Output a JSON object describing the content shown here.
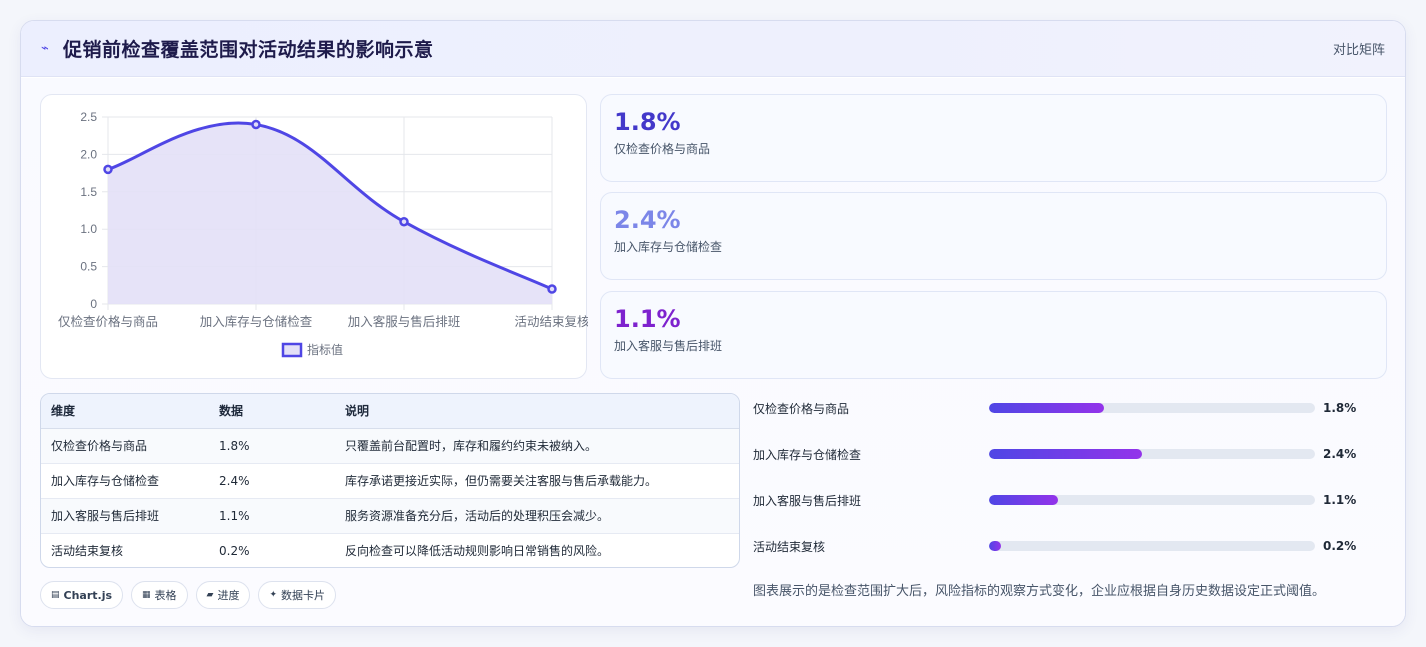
{
  "header": {
    "title": "促销前检查覆盖范围对活动结果的影响示意",
    "icon": "trend-icon",
    "right_label": "对比矩阵"
  },
  "chart_data": {
    "type": "line",
    "categories": [
      "仅检查价格与商品",
      "加入库存与仓储检查",
      "加入客服与售后排班",
      "活动结束复核"
    ],
    "series": [
      {
        "name": "指标值",
        "values": [
          1.8,
          2.4,
          1.1,
          0.2
        ]
      }
    ],
    "ylim": [
      0,
      2.5
    ],
    "yticks": [
      "0",
      "0.5",
      "1.0",
      "1.5",
      "2.0",
      "2.5"
    ],
    "grid": true,
    "legend_position": "bottom",
    "fill": true,
    "smooth": true,
    "line_color": "#4f46e5",
    "fill_color": "#e3e0f7"
  },
  "kpis": [
    {
      "value": "1.8%",
      "label": "仅检查价格与商品",
      "color": "#4338ca"
    },
    {
      "value": "2.4%",
      "label": "加入库存与仓储检查",
      "color": "#7c86e8"
    },
    {
      "value": "1.1%",
      "label": "加入客服与售后排班",
      "color": "#7e22ce"
    }
  ],
  "table": {
    "headers": [
      "维度",
      "数据",
      "说明"
    ],
    "rows": [
      [
        "仅检查价格与商品",
        "1.8%",
        "只覆盖前台配置时，库存和履约约束未被纳入。"
      ],
      [
        "加入库存与仓储检查",
        "2.4%",
        "库存承诺更接近实际，但仍需要关注客服与售后承载能力。"
      ],
      [
        "加入客服与售后排班",
        "1.1%",
        "服务资源准备充分后，活动后的处理积压会减少。"
      ],
      [
        "活动结束复核",
        "0.2%",
        "反向检查可以降低活动规则影响日常销售的风险。"
      ]
    ]
  },
  "chips": [
    {
      "label": "Chart.js",
      "icon": "chart-icon",
      "glyph": "▤"
    },
    {
      "label": "表格",
      "icon": "table-icon",
      "glyph": "▦"
    },
    {
      "label": "进度",
      "icon": "progress-icon",
      "glyph": "▰"
    },
    {
      "label": "数据卡片",
      "icon": "sparkle-icon",
      "glyph": "✦"
    }
  ],
  "progress": [
    {
      "label": "仅检查价格与商品",
      "value": "1.8%",
      "fraction": 0.352
    },
    {
      "label": "加入库存与仓储检查",
      "value": "2.4%",
      "fraction": 0.469
    },
    {
      "label": "加入客服与售后排班",
      "value": "1.1%",
      "fraction": 0.212
    },
    {
      "label": "活动结束复核",
      "value": "0.2%",
      "fraction": 0.036
    }
  ],
  "footnote": "图表展示的是检查范围扩大后，风险指标的观察方式变化，企业应根据自身历史数据设定正式阈值。"
}
